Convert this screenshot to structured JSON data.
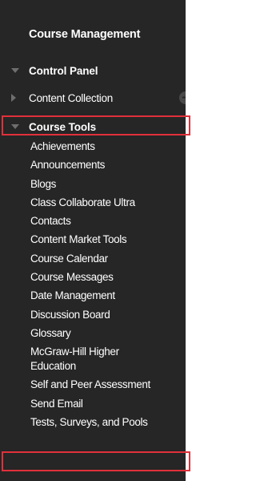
{
  "panel": {
    "title": "Course Management",
    "sections": {
      "control_panel": "Control Panel",
      "content_collection": "Content Collection",
      "course_tools": "Course Tools"
    },
    "course_tools_items": [
      "Achievements",
      "Announcements",
      "Blogs",
      "Class Collaborate Ultra",
      "Contacts",
      "Content Market Tools",
      "Course Calendar",
      "Course Messages",
      "Date Management",
      "Discussion Board",
      "Glossary",
      "McGraw-Hill Higher Education",
      "Self and Peer Assessment",
      "Send Email",
      "Tests, Surveys, and Pools"
    ]
  },
  "colors": {
    "panel_background": "#262626",
    "text": "#ffffff",
    "highlight_border": "#e0303a",
    "arrow_icon": "#6e6e6e"
  },
  "icons": {
    "expanded": "triangle-down",
    "collapsed": "triangle-right",
    "go": "circle-arrow-right"
  }
}
